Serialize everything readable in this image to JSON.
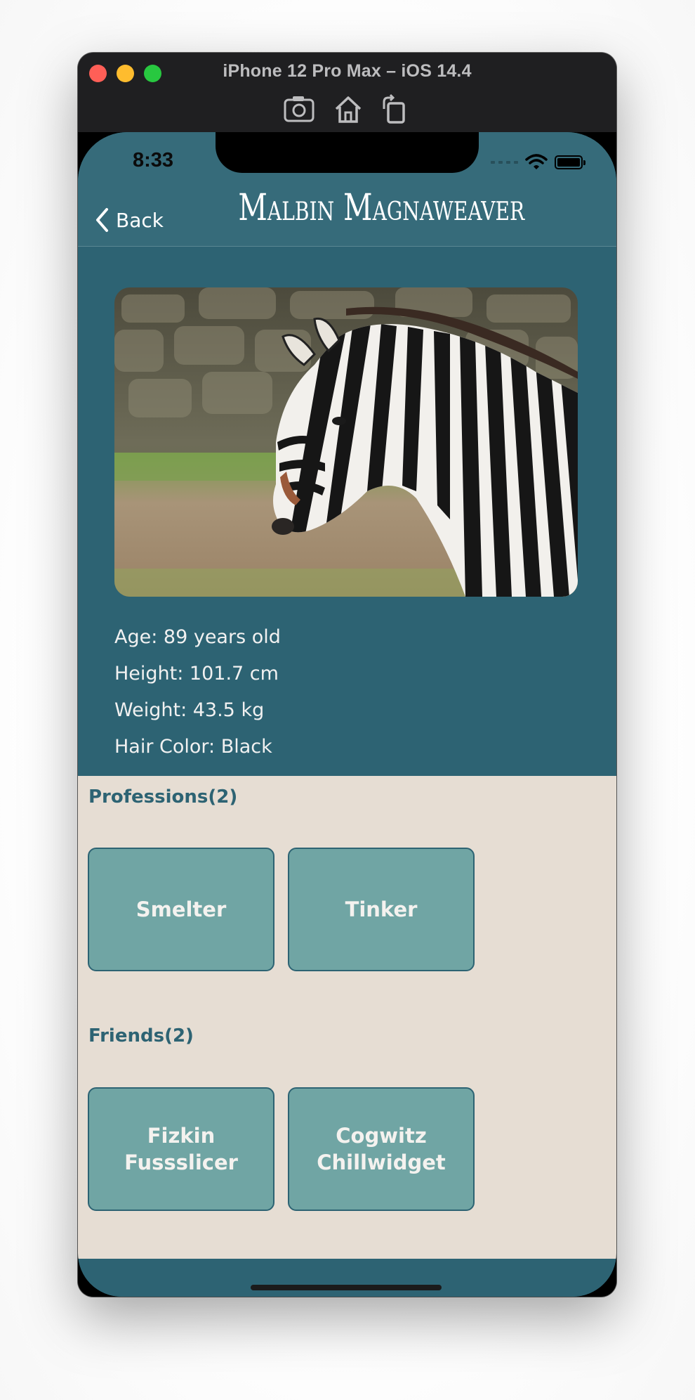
{
  "simulator": {
    "title": "iPhone 12 Pro Max – iOS 14.4",
    "toolbar": [
      "screenshot-icon",
      "home-icon",
      "rotate-icon"
    ]
  },
  "status_bar": {
    "time": "8:33"
  },
  "nav": {
    "back_label": "Back",
    "title": "Malbin Magnaweaver"
  },
  "profile": {
    "photo_subject": "zebra-photo",
    "age": "Age: 89 years old",
    "height": "Height: 101.7 cm",
    "weight": "Weight: 43.5 kg",
    "hair_color": "Hair Color: Black"
  },
  "professions": {
    "title": "Professions(2)",
    "items": [
      "Smelter",
      "Tinker"
    ]
  },
  "friends": {
    "title": "Friends(2)",
    "items": [
      "Fizkin Fussslicer",
      "Cogwitz Chillwidget"
    ]
  },
  "colors": {
    "accent": "#2d6373",
    "navbar": "#366b7a",
    "card": "#70a5a4",
    "background_lower": "#e6ddd3"
  }
}
